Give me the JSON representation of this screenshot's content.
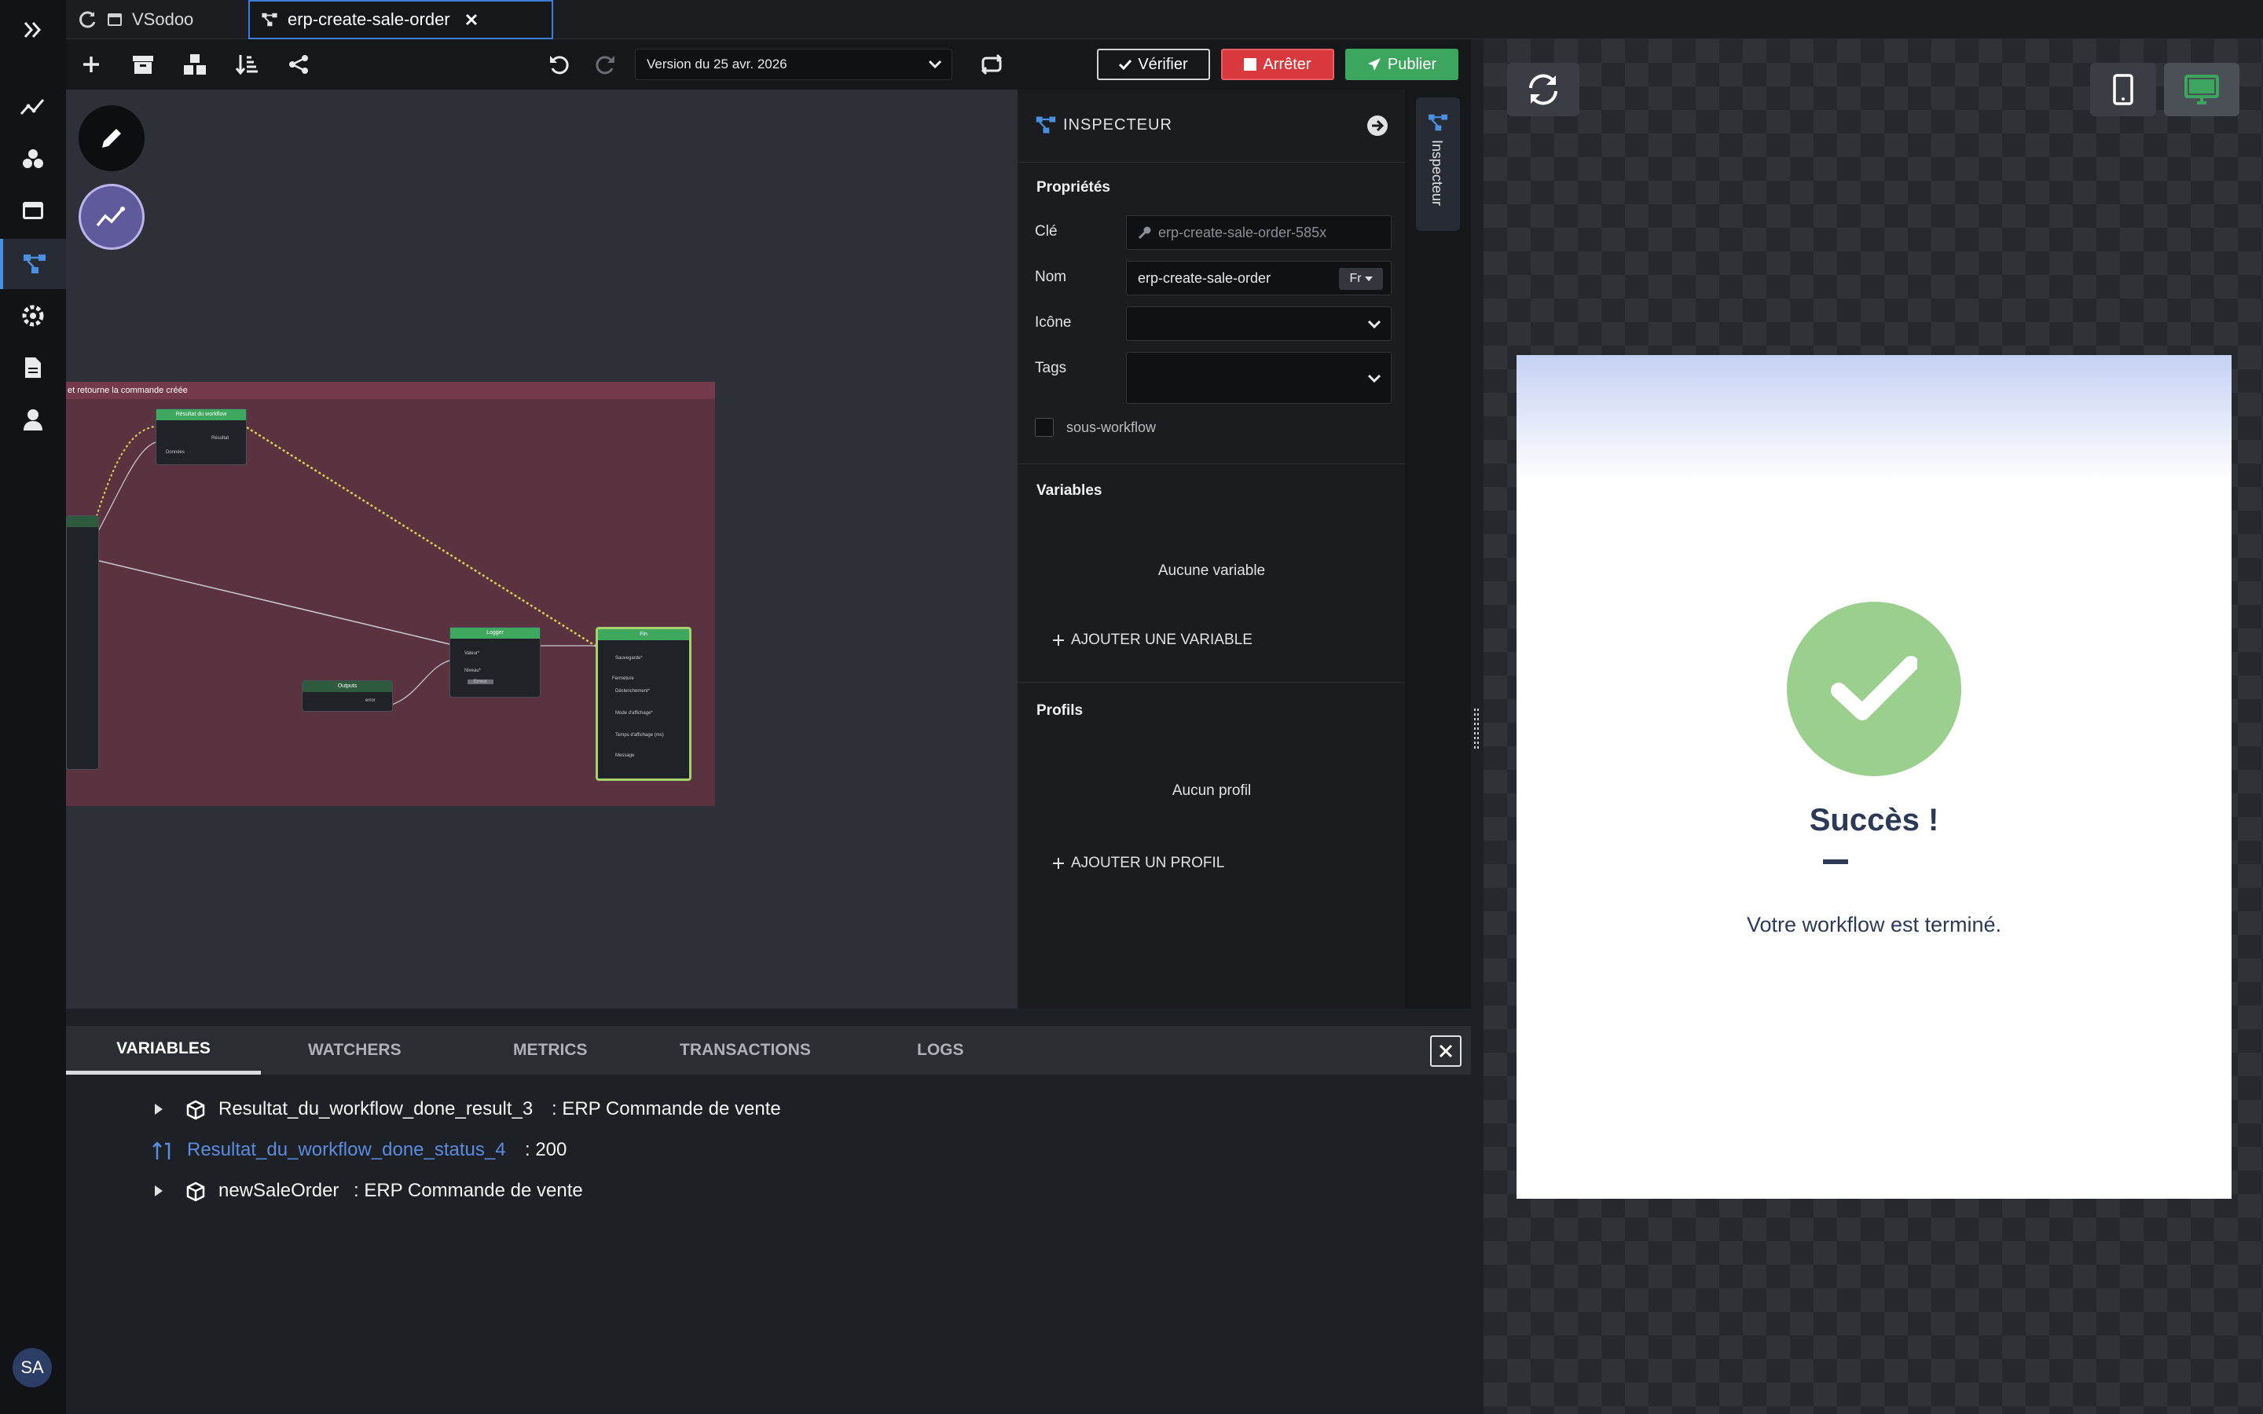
{
  "tabs": [
    {
      "label": "VSodoo"
    },
    {
      "label": "erp-create-sale-order"
    }
  ],
  "toolbar": {
    "version_label": "Version du 25 avr. 2026",
    "verify_label": "Vérifier",
    "stop_label": "Arrêter",
    "publish_label": "Publier"
  },
  "canvas": {
    "group_title": "et retourne la commande créée",
    "nodes": {
      "result_title": "Résultat du workflow",
      "result_label": "Résultat",
      "result_data": "Données",
      "logger_title": "Logger",
      "logger_value": "Valeur*",
      "logger_level": "Niveau*",
      "logger_level_value": "Erreur",
      "outputs_title": "Outputs",
      "outputs_label": "error",
      "end_title": "Fin",
      "end_save": "Sauvegarde*",
      "end_close": "Fermeture",
      "end_trigger": "Déclenchement*",
      "end_display": "Mode d'affichage*",
      "end_time": "Temps d'affichage (ms)",
      "end_message": "Message"
    }
  },
  "inspector": {
    "title": "INSPECTEUR",
    "side_tab": "Inspecteur",
    "properties_title": "Propriétés",
    "key_label": "Clé",
    "key_placeholder": "erp-create-sale-order-585x",
    "name_label": "Nom",
    "name_value": "erp-create-sale-order",
    "lang": "Fr",
    "icon_label": "Icône",
    "tags_label": "Tags",
    "subworkflow_label": "sous-workflow",
    "variables_title": "Variables",
    "no_variable": "Aucune variable",
    "add_variable": "AJOUTER UNE VARIABLE",
    "profiles_title": "Profils",
    "no_profile": "Aucun profil",
    "add_profile": "AJOUTER UN PROFIL"
  },
  "debug": {
    "tabs": [
      "VARIABLES",
      "WATCHERS",
      "METRICS",
      "TRANSACTIONS",
      "LOGS"
    ],
    "rows": [
      {
        "name": "Resultat_du_workflow_done_result_3",
        "value": ": ERP Commande de vente"
      },
      {
        "name": "Resultat_du_workflow_done_status_4",
        "value": ": 200"
      },
      {
        "name": "newSaleOrder",
        "value": ": ERP Commande de vente"
      }
    ]
  },
  "preview": {
    "success_title": "Succès !",
    "success_message": "Votre workflow est terminé."
  },
  "user": {
    "initials": "SA"
  },
  "colors": {
    "accent": "#4a90e2",
    "success": "#3ca65f",
    "danger": "#d9383c",
    "success_circle": "#9bcf8d",
    "group_bg": "#5b3340"
  }
}
